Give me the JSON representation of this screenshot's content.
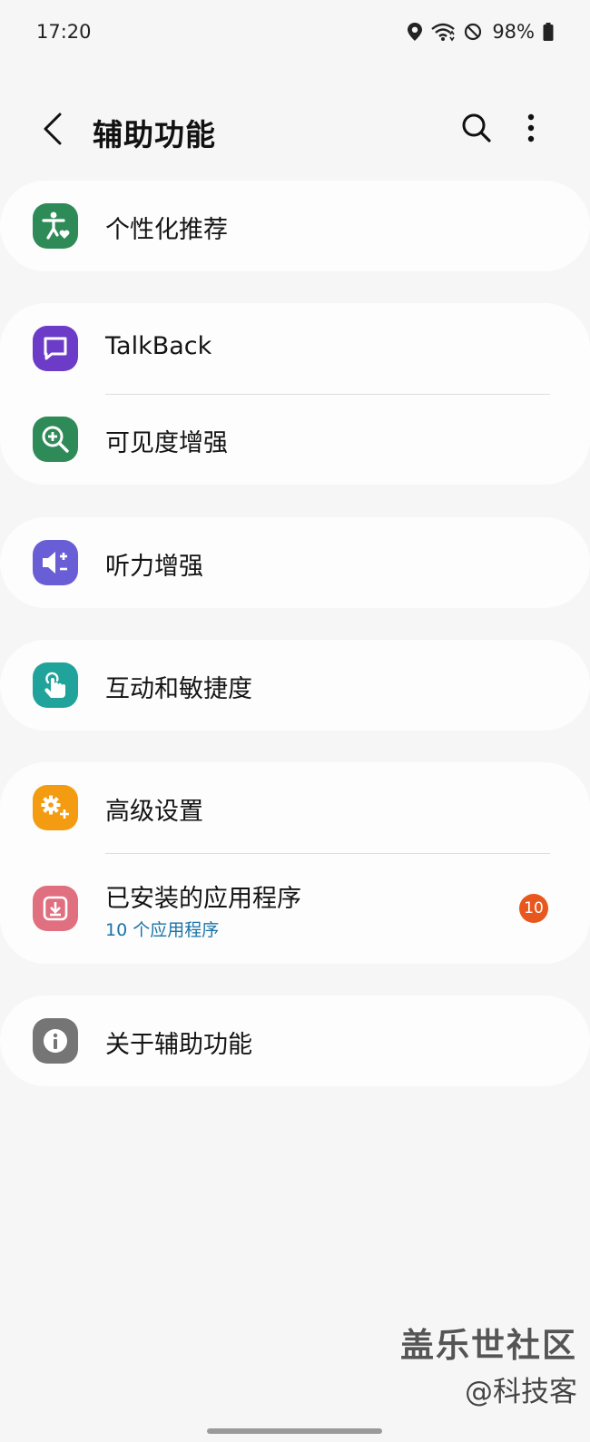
{
  "status_bar": {
    "time": "17:20",
    "battery": "98%",
    "icons": [
      "location-icon",
      "wifi-icon",
      "do-not-disturb-icon",
      "battery-icon"
    ]
  },
  "header": {
    "title": "辅助功能",
    "back_icon": "chevron-left-icon",
    "search_icon": "search-icon",
    "more_icon": "more-vertical-icon"
  },
  "groups": [
    {
      "items": [
        {
          "label": "个性化推荐",
          "icon": "accessibility-heart-icon",
          "color": "#2e8b57"
        }
      ]
    },
    {
      "items": [
        {
          "label": "TalkBack",
          "icon": "chat-box-icon",
          "color": "#6c3bc7"
        },
        {
          "label": "可见度增强",
          "icon": "zoom-in-icon",
          "color": "#2e8b57"
        }
      ]
    },
    {
      "items": [
        {
          "label": "听力增强",
          "icon": "volume-adjust-icon",
          "color": "#6a5ed6"
        }
      ]
    },
    {
      "items": [
        {
          "label": "互动和敏捷度",
          "icon": "touch-hand-icon",
          "color": "#20a39a"
        }
      ]
    },
    {
      "items": [
        {
          "label": "高级设置",
          "icon": "gear-plus-icon",
          "color": "#f39c12"
        },
        {
          "label": "已安装的应用程序",
          "sub": "10 个应用程序",
          "badge": "10",
          "icon": "download-icon",
          "color": "#e0707f"
        }
      ]
    },
    {
      "items": [
        {
          "label": "关于辅助功能",
          "icon": "info-icon",
          "color": "#757575"
        }
      ]
    }
  ],
  "watermark": {
    "line1": "盖乐世社区",
    "line2": "@科技客"
  }
}
